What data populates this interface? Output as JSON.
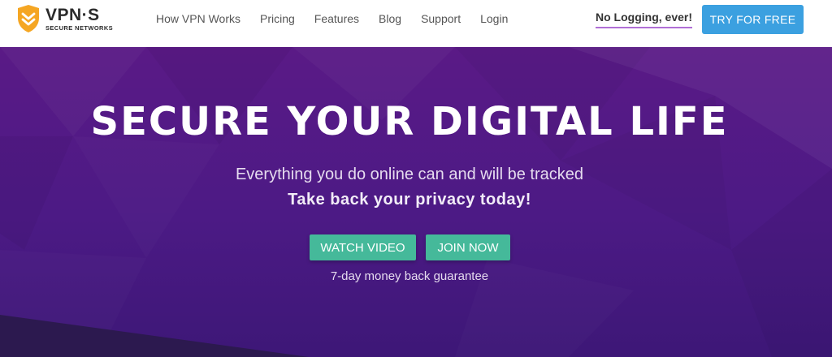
{
  "logo": {
    "name": "VPN·S",
    "subtitle": "SECURE NETWORKS"
  },
  "nav": {
    "links": [
      "How VPN Works",
      "Pricing",
      "Features",
      "Blog",
      "Support",
      "Login"
    ],
    "tagline": "No Logging, ever!",
    "cta_label": "TRY FOR FREE"
  },
  "hero": {
    "title": "SECURE YOUR DIGITAL LIFE",
    "subtitle": "Everything you do online can and will be tracked",
    "subtitle_bold": "Take back your privacy today!",
    "watch_label": "WATCH VIDEO",
    "join_label": "JOIN NOW",
    "guarantee": "7-day money back guarantee"
  },
  "colors": {
    "accent_blue": "#3ba0e0",
    "hero_purple": "#4c1a85",
    "button_green": "#45b99a",
    "logo_orange": "#f5a623"
  }
}
